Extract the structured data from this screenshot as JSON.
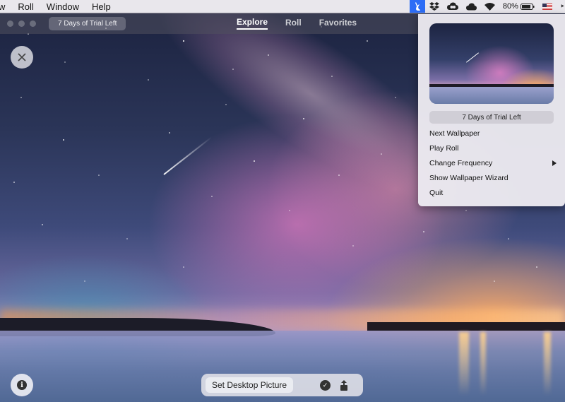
{
  "menubar": {
    "items": [
      "w",
      "Roll",
      "Window",
      "Help"
    ],
    "battery": "80%"
  },
  "toolbar": {
    "trial": "7 Days of Trial Left",
    "tabs": [
      {
        "label": "Explore",
        "active": true
      },
      {
        "label": "Roll",
        "active": false
      },
      {
        "label": "Favorites",
        "active": false
      }
    ]
  },
  "bottom_bar": {
    "set_label": "Set Desktop Picture"
  },
  "dropdown": {
    "trial": "7 Days of Trial Left",
    "items": [
      "Next Wallpaper",
      "Play Roll",
      "Change Frequency",
      "Show Wallpaper Wizard",
      "Quit"
    ]
  },
  "icons": {
    "close": "close-icon",
    "info": "info-icon",
    "check": "checkmark-icon",
    "share": "share-icon",
    "app": "rabbit-icon",
    "dropbox": "dropbox-icon",
    "cloud": "cloud-icon",
    "wifi": "wifi-icon",
    "flag": "us-flag-icon"
  },
  "colors": {
    "accent": "#2d6df6",
    "menubar": "#e9e7ec"
  }
}
